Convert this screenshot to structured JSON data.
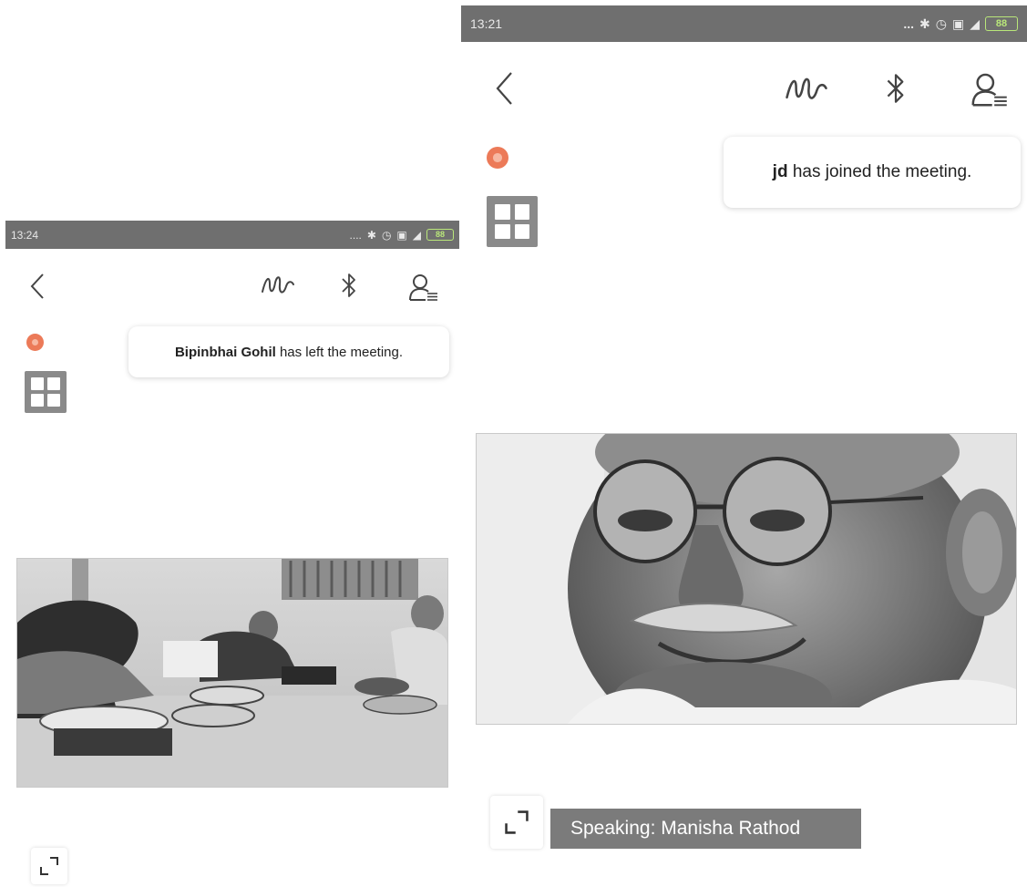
{
  "left_screen": {
    "status_bar": {
      "time": "13:24",
      "dots": "....",
      "battery": "88"
    },
    "toast": {
      "name": "Bipinbhai Gohil",
      "message": " has left the meeting."
    }
  },
  "right_screen": {
    "status_bar": {
      "time": "13:21",
      "dots": "...",
      "battery": "88"
    },
    "toast": {
      "name": "jd",
      "message": " has joined the meeting."
    },
    "speaking_label": "Speaking: Manisha Rathod"
  },
  "icons": [
    "back-icon",
    "scribble-icon",
    "bluetooth-icon",
    "participants-icon",
    "notification-dot-icon",
    "grid-view-icon",
    "expand-icon"
  ],
  "colors": {
    "status_bar": "#6f6f6f",
    "notification_dot": "#ec7a58",
    "grid_button": "#8a8a8a",
    "speaking_bar": "#7b7b7b"
  }
}
